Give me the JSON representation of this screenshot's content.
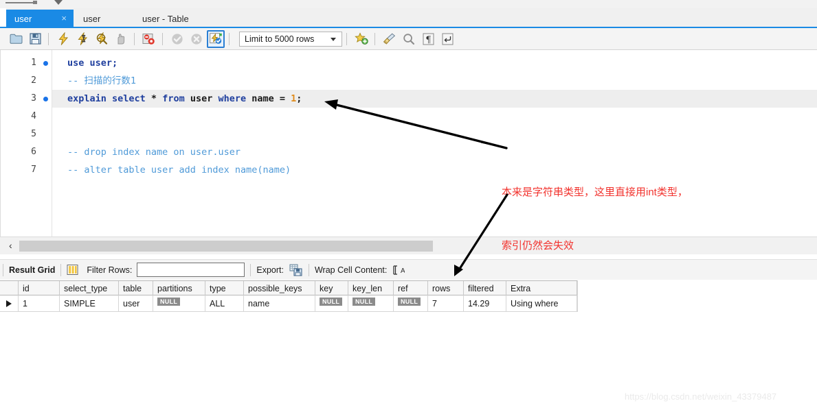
{
  "window": {
    "tabs": [
      {
        "label": "user",
        "active": true,
        "close_icon": "×"
      },
      {
        "label": "user",
        "active": false
      },
      {
        "label": "user - Table",
        "active": false
      }
    ]
  },
  "toolbar": {
    "icons": [
      "open-folder-icon",
      "save-file-icon",
      "execute-statement-icon",
      "execute-current-statement-icon",
      "explain-statement-icon",
      "stop-execution-icon",
      "toggle-breakpoint-icon",
      "commit-transaction-icon",
      "rollback-transaction-icon",
      "toggle-autocommit-icon"
    ],
    "limit_selector": {
      "value": "Limit to 5000 rows",
      "caret": "▾"
    },
    "right_icons": [
      "beautify-sql-icon",
      "clear-context-icon",
      "find-icon",
      "toggle-invisible-chars-icon",
      "toggle-wrap-lines-icon"
    ]
  },
  "editor": {
    "lines": [
      {
        "number": "1",
        "breakpoint": true,
        "highlighted": false,
        "tokens": [
          {
            "text": "use user;",
            "style": "k"
          }
        ]
      },
      {
        "number": "2",
        "breakpoint": false,
        "highlighted": false,
        "tokens": [
          {
            "text": "-- 扫描的行数1",
            "style": "cmt"
          }
        ]
      },
      {
        "number": "3",
        "breakpoint": true,
        "highlighted": true,
        "tokens": [
          {
            "text": "explain select ",
            "style": "k"
          },
          {
            "text": "* ",
            "style": "plain"
          },
          {
            "text": "from ",
            "style": "k"
          },
          {
            "text": "user ",
            "style": "plain"
          },
          {
            "text": "where ",
            "style": "k"
          },
          {
            "text": "name ",
            "style": "plain"
          },
          {
            "text": "= ",
            "style": "plain"
          },
          {
            "text": "1",
            "style": "num"
          },
          {
            "text": ";",
            "style": "plain"
          }
        ]
      },
      {
        "number": "4",
        "breakpoint": false,
        "highlighted": false,
        "tokens": []
      },
      {
        "number": "5",
        "breakpoint": false,
        "highlighted": false,
        "tokens": []
      },
      {
        "number": "6",
        "breakpoint": false,
        "highlighted": false,
        "tokens": [
          {
            "text": "-- drop index name on user.user",
            "style": "cmt"
          }
        ]
      },
      {
        "number": "7",
        "breakpoint": false,
        "highlighted": false,
        "tokens": [
          {
            "text": "-- alter table user add index name(name)",
            "style": "cmt"
          }
        ]
      }
    ]
  },
  "scrollbar": {
    "left_chevron": "‹"
  },
  "result_toolbar": {
    "title": "Result Grid",
    "grid_view_icon": "grid-view-icon",
    "filter_label": "Filter Rows:",
    "filter_value": "",
    "filter_placeholder": "",
    "export_label": "Export:",
    "export_icon": "export-recordset-icon",
    "wrap_label": "Wrap Cell Content:",
    "wrap_icon": "wrap-cell-content-icon"
  },
  "result_grid": {
    "columns": [
      "id",
      "select_type",
      "table",
      "partitions",
      "type",
      "possible_keys",
      "key",
      "key_len",
      "ref",
      "rows",
      "filtered",
      "Extra"
    ],
    "rows": [
      {
        "marker": "▶",
        "cells": [
          {
            "value": "1",
            "null": false
          },
          {
            "value": "SIMPLE",
            "null": false
          },
          {
            "value": "user",
            "null": false
          },
          {
            "value": "NULL",
            "null": true
          },
          {
            "value": "ALL",
            "null": false
          },
          {
            "value": "name",
            "null": false
          },
          {
            "value": "NULL",
            "null": true
          },
          {
            "value": "NULL",
            "null": true
          },
          {
            "value": "NULL",
            "null": true
          },
          {
            "value": "7",
            "null": false
          },
          {
            "value": "14.29",
            "null": false
          },
          {
            "value": "Using where",
            "null": false
          }
        ]
      }
    ]
  },
  "annotations": {
    "color": "#f2332e",
    "note_line_1": "本来是字符串类型，这里直接用int类型，",
    "note_line_2": "索引仍然会失效",
    "arrows": [
      {
        "name": "arrow-to-sql-statement"
      },
      {
        "name": "arrow-to-result-row"
      }
    ]
  },
  "watermark": {
    "text": "https://blog.csdn.net/weixin_43379487"
  }
}
